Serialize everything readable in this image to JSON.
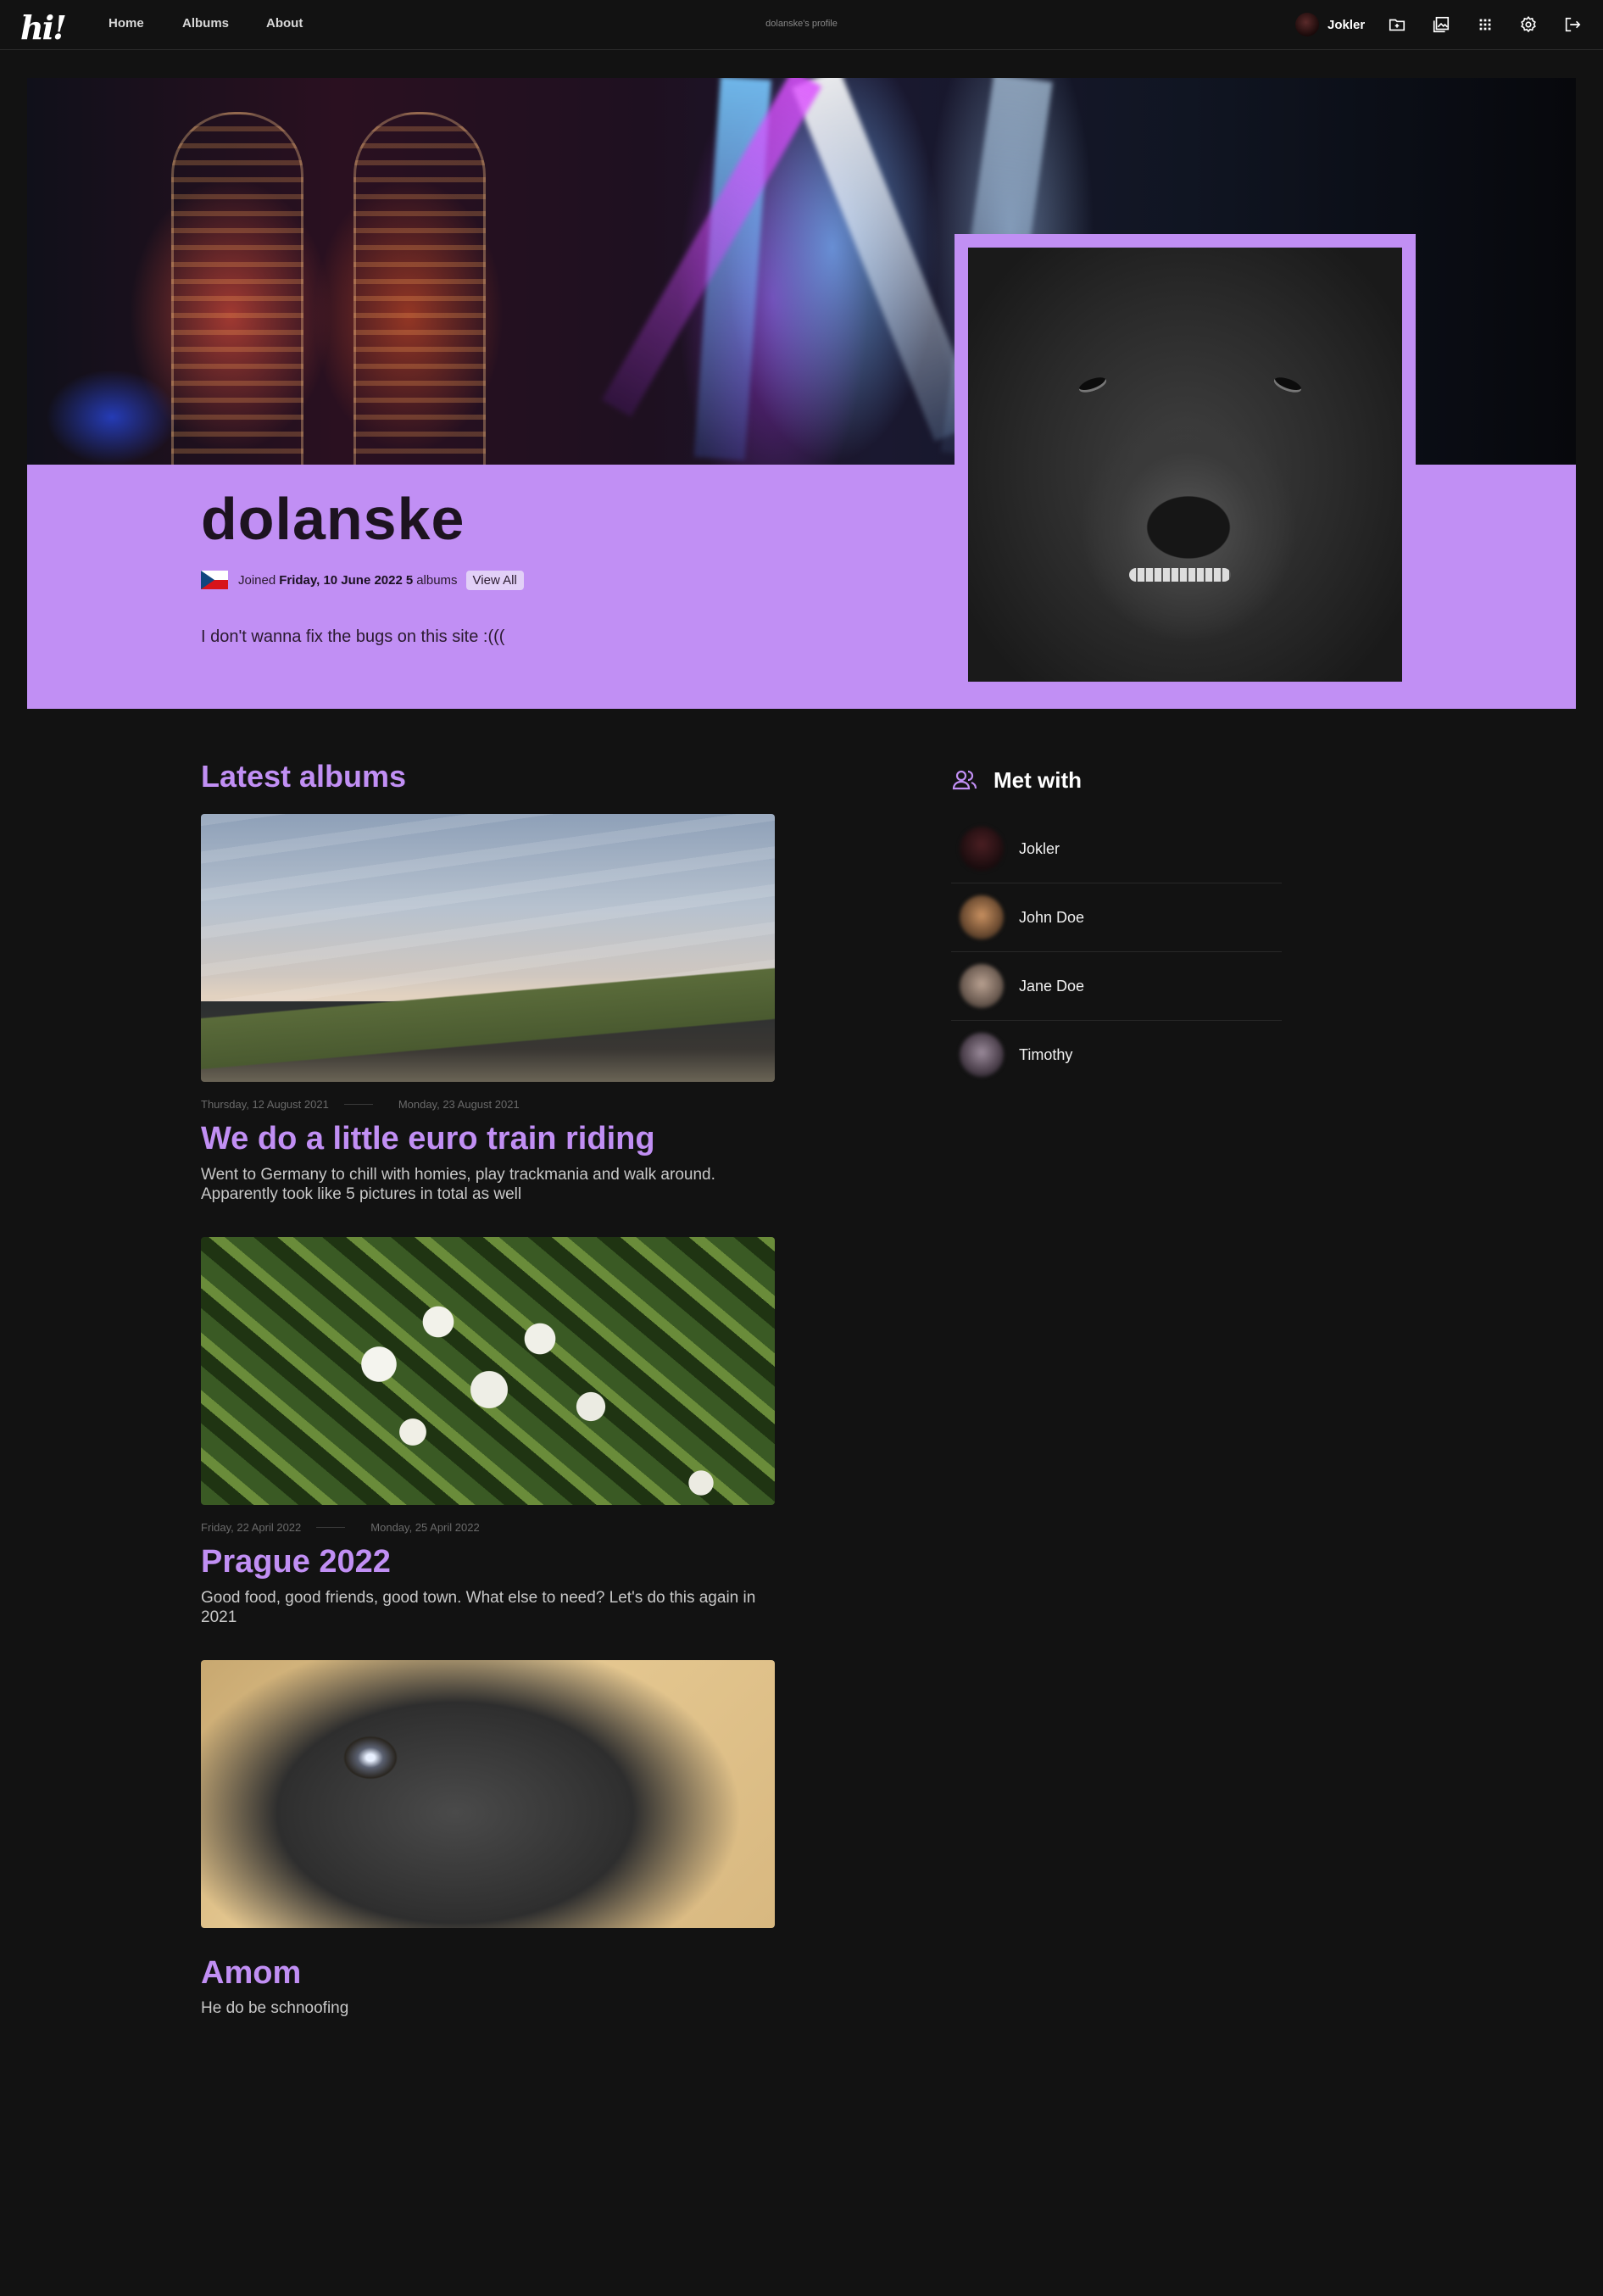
{
  "nav": {
    "logo": "hi!",
    "links": [
      "Home",
      "Albums",
      "About"
    ],
    "page_label": "dolanske's profile",
    "user_name": "Jokler",
    "icons": [
      "new-album-icon",
      "gallery-icon",
      "apps-grid-icon",
      "settings-gear-icon",
      "logout-icon"
    ]
  },
  "profile": {
    "username": "dolanske",
    "country_flag": "czech-flag",
    "joined_prefix": "Joined",
    "joined_date": "Friday, 10 June 2022",
    "albums_count": "5",
    "albums_label": "albums",
    "view_all": "View All",
    "bio": "I don't wanna fix the bugs on this site :((("
  },
  "albums": {
    "title": "Latest albums",
    "items": [
      {
        "date_start": "Thursday, 12 August 2021",
        "date_end": "Monday, 23 August 2021",
        "title": "We do a little euro train riding",
        "description": "Went to Germany to chill with homies, play trackmania and walk around. Apparently took like 5 pictures in total as well"
      },
      {
        "date_start": "Friday, 22 April 2022",
        "date_end": "Monday, 25 April 2022",
        "title": "Prague 2022",
        "description": "Good food, good friends, good town. What else to need? Let's do this again in 2021"
      },
      {
        "date_start": "",
        "date_end": "",
        "title": "Amom",
        "description": "He do be schnoofing"
      }
    ]
  },
  "met_with": {
    "title": "Met with",
    "people": [
      "Jokler",
      "John Doe",
      "Jane Doe",
      "Timothy"
    ]
  },
  "colors": {
    "accent": "#c18ff4",
    "background": "#121212"
  }
}
